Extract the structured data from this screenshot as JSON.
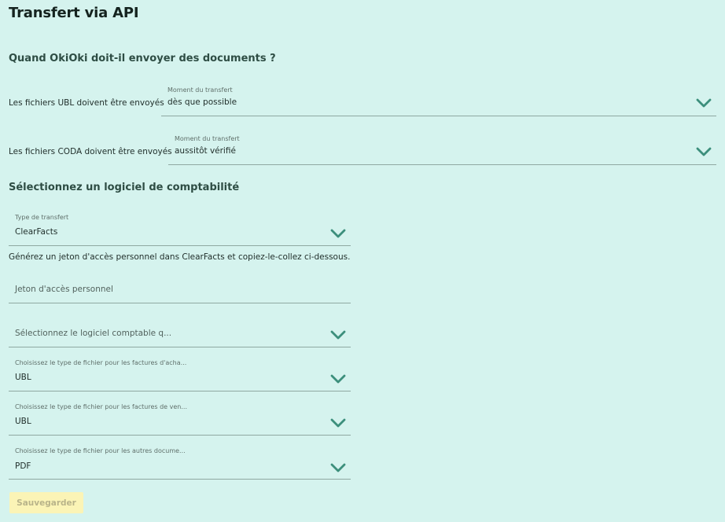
{
  "page": {
    "title": "Transfert via API"
  },
  "schedule": {
    "heading": "Quand OkiOki doit-il envoyer des documents ?",
    "ubl": {
      "row_label": "Les fichiers UBL doivent être envoyés",
      "field_label": "Moment du transfert",
      "value": "dès que possible"
    },
    "coda": {
      "row_label": "Les fichiers CODA doivent être envoyés",
      "field_label": "Moment du transfert",
      "value": "aussitôt vérifié"
    }
  },
  "software": {
    "heading": "Sélectionnez un logiciel de comptabilité",
    "transfer_type": {
      "label": "Type de transfert",
      "value": "ClearFacts"
    },
    "help_text": "Générez un jeton d'accès personnel dans ClearFacts et copiez-le-collez ci-dessous.",
    "token": {
      "placeholder": "Jeton d'accès personnel",
      "value": ""
    },
    "accounting_software": {
      "placeholder": "Sélectionnez le logiciel comptable q..."
    },
    "purchase_file_type": {
      "label": "Choisissez le type de fichier pour les factures d'acha...",
      "value": "UBL"
    },
    "sales_file_type": {
      "label": "Choisissez le type de fichier pour les factures de ven...",
      "value": "UBL"
    },
    "other_file_type": {
      "label": "Choisissez le type de fichier pour les autres docume...",
      "value": "PDF"
    }
  },
  "actions": {
    "save_label": "Sauvegarder"
  },
  "colors": {
    "background": "#d5f3ee",
    "chevron": "#3c8f7c",
    "save_button_bg": "#fbf4b6",
    "save_button_text": "#b9b48a"
  },
  "icons": {
    "dropdown": "chevron-down-icon"
  }
}
